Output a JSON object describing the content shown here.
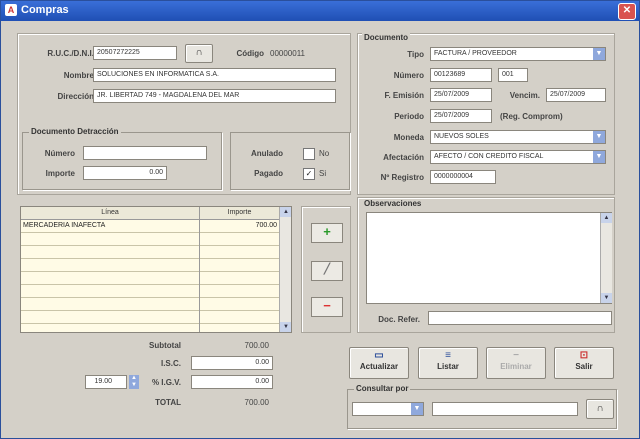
{
  "window": {
    "title": "Compras",
    "close": "✕"
  },
  "proveedor": {
    "ruc_label": "R.U.C./D.N.I.",
    "ruc_value": "20507272225",
    "codigo_label": "Código",
    "codigo_value": "00000011",
    "nombre_label": "Nombre",
    "nombre_value": "SOLUCIONES EN INFORMATICA S.A.",
    "direccion_label": "Dirección",
    "direccion_value": "JR. LIBERTAD 749 - MAGDALENA DEL MAR"
  },
  "detraccion": {
    "legend": "Documento Detracción",
    "numero_label": "Número",
    "numero_value": "",
    "importe_label": "Importe",
    "importe_value": "0.00"
  },
  "estado": {
    "anulado_label": "Anulado",
    "anulado_option": "No",
    "pagado_label": "Pagado",
    "pagado_option": "Si",
    "pagado_mark": "✓"
  },
  "documento": {
    "legend": "Documento",
    "tipo_label": "Tipo",
    "tipo_value": "FACTURA / PROVEEDOR",
    "numero_label": "Número",
    "serie_value": "00123689",
    "numero_value": "001",
    "emision_label": "F. Emisión",
    "emision_value": "25/07/2009",
    "vencim_label": "Vencim.",
    "vencim_value": "25/07/2009",
    "periodo_label": "Periodo",
    "periodo_value": "25/07/2009",
    "reg_label": "(Reg. Comprom)",
    "moneda_label": "Moneda",
    "moneda_value": "NUEVOS SOLES",
    "afectacion_label": "Afectación",
    "afectacion_value": "AFECTO / CON CREDITO FISCAL",
    "registro_label": "Nº Registro",
    "registro_value": "0000000004"
  },
  "lineas": {
    "col_linea": "Línea",
    "col_importe": "Importe",
    "rows": [
      {
        "linea": "MERCADERIA INAFECTA",
        "importe": "700.00"
      }
    ]
  },
  "totales": {
    "subtotal_label": "Subtotal",
    "subtotal_value": "700.00",
    "isc_label": "I.S.C.",
    "isc_value": "0.00",
    "igv_label": "% I.G.V.",
    "igv_rate": "19.00",
    "igv_value": "0.00",
    "total_label": "TOTAL",
    "total_value": "700.00"
  },
  "observaciones": {
    "legend": "Observaciones",
    "text": "",
    "doc_refer_label": "Doc. Refer.",
    "doc_refer_value": ""
  },
  "side_buttons": {
    "add": "+",
    "edit": "",
    "remove": "−"
  },
  "actions": {
    "actualizar": "Actualizar",
    "listar": "Listar",
    "eliminar": "Eliminar",
    "salir": "Salir"
  },
  "consultar": {
    "legend": "Consultar por",
    "combo_value": "",
    "text_value": ""
  }
}
